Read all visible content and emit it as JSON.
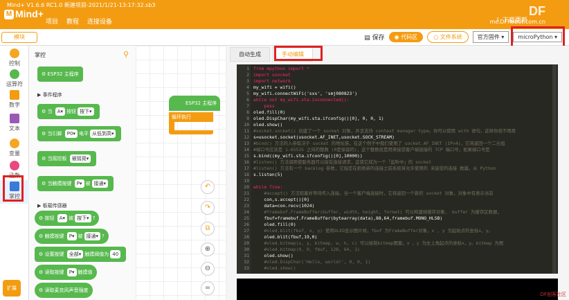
{
  "app": {
    "title": "Mind+ V1.6.6 RC1.0   新建项目-2021/1/21-13:17:32.sb3",
    "logo": "Mind+",
    "menus": [
      "项目",
      "教程",
      "连接设备"
    ],
    "download_update": "下载更新",
    "brand": "DF",
    "brand_sub": "mc.DFRobot.com.cn"
  },
  "toolbar": {
    "mode": "模块",
    "save": "保存",
    "code_btn": "代码区",
    "file_btn": "文件系统",
    "firmware": "官方固件",
    "language": "microPython"
  },
  "categories": [
    {
      "label": "控制",
      "color": "#f5a623"
    },
    {
      "label": "运算符",
      "color": "#57b84e"
    },
    {
      "label": "数字",
      "color": "#f39c12"
    },
    {
      "label": "文本",
      "color": "#9b59b6"
    },
    {
      "label": "变量",
      "color": "#f5a623"
    },
    {
      "label": "函数",
      "color": "#e84a7f"
    },
    {
      "label": "掌控",
      "color": "#3b7bd8"
    }
  ],
  "expand_label": "扩展",
  "palette": {
    "title": "掌控",
    "section1": "事件程序",
    "section2": "板载传感器",
    "blocks": [
      {
        "text": "ESP32 主程序"
      },
      {
        "text": "当",
        "chip1": "A▾",
        "mid": "按钮",
        "chip2": "按下▾"
      },
      {
        "text": "当引脚",
        "chip1": "P0▾",
        "mid": "电平",
        "chip2": "从低到高▾"
      },
      {
        "text": "当摇控板",
        "chip1": "被摇晃▾"
      },
      {
        "text": "当触摸按键",
        "chip1": "P▾",
        "mid": "被",
        "chip2": "接通▾"
      },
      {
        "text": "按钮",
        "chip1": "A▾",
        "mid": "被",
        "chip2": "按下▾",
        "tail": "?"
      },
      {
        "text": "触摸按键",
        "chip1": "P▾",
        "mid": "被",
        "chip2": "接通▾",
        "tail": "?"
      },
      {
        "text": "设置按键",
        "chip1": "全部▾",
        "mid": "触摸阈值为",
        "chip2": "40"
      },
      {
        "text": "读取按键",
        "chip1": "P▾",
        "mid": "触摸值"
      },
      {
        "text": "读取麦克风声音强度"
      }
    ]
  },
  "workspace": {
    "main_block": "ESP32 主程序",
    "loop_block": "循环执行"
  },
  "editor": {
    "tabs": [
      "自动生成",
      "手动编辑"
    ],
    "code_lines": [
      {
        "n": "1",
        "t": "from mpython import *",
        "c": "kw"
      },
      {
        "n": "2",
        "t": "import usocket",
        "c": "kw"
      },
      {
        "n": "3",
        "t": "import network",
        "c": "kw"
      },
      {
        "n": "4",
        "t": "my_wifi = wifi()",
        "c": ""
      },
      {
        "n": "5",
        "t": "my_wifi.connectWiFi('sxs', 'smj080823')",
        "c": ""
      },
      {
        "n": "6",
        "t": "while not my_wifi.sta.isconnected():",
        "c": "kw"
      },
      {
        "n": "7",
        "t": "    pass",
        "c": "kw"
      },
      {
        "n": "8",
        "t": "oled.fill(0)",
        "c": ""
      },
      {
        "n": "9",
        "t": "oled.DispChar(my_wifi.sta.ifconfig()[0], 0, 0, 1)",
        "c": ""
      },
      {
        "n": "10",
        "t": "oled.show()",
        "c": ""
      },
      {
        "n": "11",
        "t": "#socket.socket() 创建了一个 socket 对象，并且支持 context manager type。你可以使用 with 语句，这样你就不用再",
        "c": "cm"
      },
      {
        "n": "12",
        "t": "s=usocket.socket(usocket.AF_INET,usocket.SOCK_STREAM)",
        "c": ""
      },
      {
        "n": "13",
        "t": "#bind() 方法的入参取决于 socket 的地址族，在这个例子中我们使用了 socket.AF_INET (IPv4)，它将返回一个二元组",
        "c": "cm"
      },
      {
        "n": "14",
        "t": "#端口号应该是 1-65535 之间的整数 (0是保留的)，这个整数就是用来接受客户端链接的 TCP 端口号，如果端口号是",
        "c": "cm"
      },
      {
        "n": "15",
        "t": "s.bind((my_wifi.sta.ifconfig()[0],10000))",
        "c": ""
      },
      {
        "n": "16",
        "t": "#listen() 方法调用使服务器可以接受连接请求，这使它成为一个「监听中」的 socket",
        "c": "cm"
      },
      {
        "n": "17",
        "t": "#listen() 方法有一个 backlog 参数，它指定在拒绝新的连接之前系统将允许使用的 未接受的连接 数量。从 Python",
        "c": "cm"
      },
      {
        "n": "18",
        "t": "s.listen(5)",
        "c": ""
      },
      {
        "n": "19",
        "t": "",
        "c": ""
      },
      {
        "n": "20",
        "t": "while True:",
        "c": "kw"
      },
      {
        "n": "21",
        "t": "    #accept() 方法阻塞并等待传入连接。当一个客户端连接时，它将返回一个新的 socket 对象，对象中有表示当前",
        "c": "cm"
      },
      {
        "n": "22",
        "t": "    con,s.accept()[0]",
        "c": ""
      },
      {
        "n": "23",
        "t": "    data=con.recv(1024)",
        "c": ""
      },
      {
        "n": "24",
        "t": "    #framebuf.FrameBuffer(buffer, width, height, format) 可以构建帧缓存对象， buffer 为缓存区数据，",
        "c": "cm"
      },
      {
        "n": "25",
        "t": "    fbuf=framebuf.FrameBuffer(bytearray(data),88,64,framebuf.MONO_HLSB)",
        "c": ""
      },
      {
        "n": "26",
        "t": "    oled.fill(0)",
        "c": ""
      },
      {
        "n": "27",
        "t": "    #oled.blit(fbuf, x, y) 使用OLED显示图片帧，fbuf 为FrameBuffer对象，x , y 为起始点的坐标x，y。",
        "c": "cm"
      },
      {
        "n": "28",
        "t": "    oled.blit(fbuf,19,0)",
        "c": ""
      },
      {
        "n": "29",
        "t": "    #oled.bitmap(x, y, bitmap, w, h, c) 可以绘制bitmap图案。x 、y 为左上角起点的坐标x，y。bitmap 为图",
        "c": "cm"
      },
      {
        "n": "30",
        "t": "    #oled.bitmap(0, 0, fbuf, 128, 64, 1)",
        "c": "cm"
      },
      {
        "n": "31",
        "t": "    oled.show()",
        "c": ""
      },
      {
        "n": "32",
        "t": "    #oled.DispChar('Hello, world!', 0, 0, 1)",
        "c": "cm"
      },
      {
        "n": "33",
        "t": "    #oled.show()",
        "c": "cm"
      }
    ]
  },
  "watermark": "DF创客社区"
}
